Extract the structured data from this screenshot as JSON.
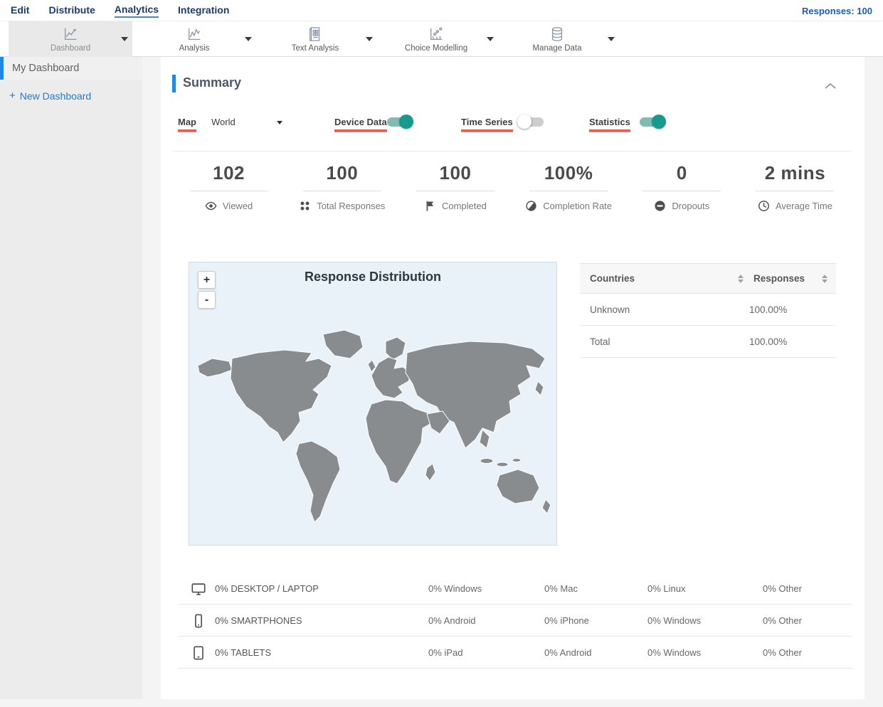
{
  "topnav": {
    "items": [
      {
        "label": "Edit"
      },
      {
        "label": "Distribute"
      },
      {
        "label": "Analytics"
      },
      {
        "label": "Integration"
      }
    ],
    "active_item": "Analytics",
    "responses_label": "Responses: 100"
  },
  "toolbar": {
    "items": [
      {
        "label": "Dashboard",
        "icon": "line-chart-icon",
        "selected": true
      },
      {
        "label": "Analysis",
        "icon": "line-chart-icon",
        "selected": false
      },
      {
        "label": "Text Analysis",
        "icon": "document-grid-icon",
        "selected": false
      },
      {
        "label": "Choice Modelling",
        "icon": "scatter-chart-icon",
        "selected": false
      },
      {
        "label": "Manage Data",
        "icon": "database-icon",
        "selected": false
      }
    ]
  },
  "sidebar": {
    "items": [
      {
        "label": "My Dashboard",
        "selected": true
      }
    ],
    "new_dashboard": {
      "icon": "plus-icon",
      "plus": "+",
      "label": "New Dashboard"
    }
  },
  "summary": {
    "title": "Summary",
    "controls": {
      "map_label": "Map",
      "map_value": "World",
      "device_data_label": "Device Data",
      "device_data_on": true,
      "time_series_label": "Time Series",
      "time_series_on": false,
      "statistics_label": "Statistics",
      "statistics_on": true
    },
    "stats": [
      {
        "value": "102",
        "label": "Viewed",
        "icon": "eye-icon"
      },
      {
        "value": "100",
        "label": "Total Responses",
        "icon": "dots-grid-icon"
      },
      {
        "value": "100",
        "label": "Completed",
        "icon": "flag-icon"
      },
      {
        "value": "100%",
        "label": "Completion Rate",
        "icon": "half-circle-icon"
      },
      {
        "value": "0",
        "label": "Dropouts",
        "icon": "minus-circle-icon"
      },
      {
        "value": "2 mins",
        "label": "Average Time",
        "icon": "clock-icon"
      }
    ],
    "map": {
      "title": "Response Distribution",
      "zoom_in_label": "+",
      "zoom_out_label": "-"
    },
    "countries_table": {
      "headers": [
        "Countries",
        "Responses"
      ],
      "rows": [
        {
          "country": "Unknown",
          "responses": "100.00%"
        },
        {
          "country": "Total",
          "responses": "100.00%"
        }
      ]
    },
    "device_table": {
      "rows": [
        {
          "icon": "desktop-icon",
          "cells": [
            "0% DESKTOP / LAPTOP",
            "0% Windows",
            "0% Mac",
            "0% Linux",
            "0% Other"
          ]
        },
        {
          "icon": "smartphone-icon",
          "cells": [
            "0% SMARTPHONES",
            "0% Android",
            "0% iPhone",
            "0% Windows",
            "0% Other"
          ]
        },
        {
          "icon": "tablet-icon",
          "cells": [
            "0% TABLETS",
            "0% iPad",
            "0% Android",
            "0% Windows",
            "0% Other"
          ]
        }
      ]
    }
  },
  "colors": {
    "accent_blue": "#1e88e5",
    "nav_navy": "#1d3a6d",
    "toggle_on_teal": "#17998b",
    "toggle_track_teal": "#7fbdb4",
    "red_underline": "#e0604d",
    "map_background": "#e9f1f9",
    "country_fill": "#898c8f"
  }
}
